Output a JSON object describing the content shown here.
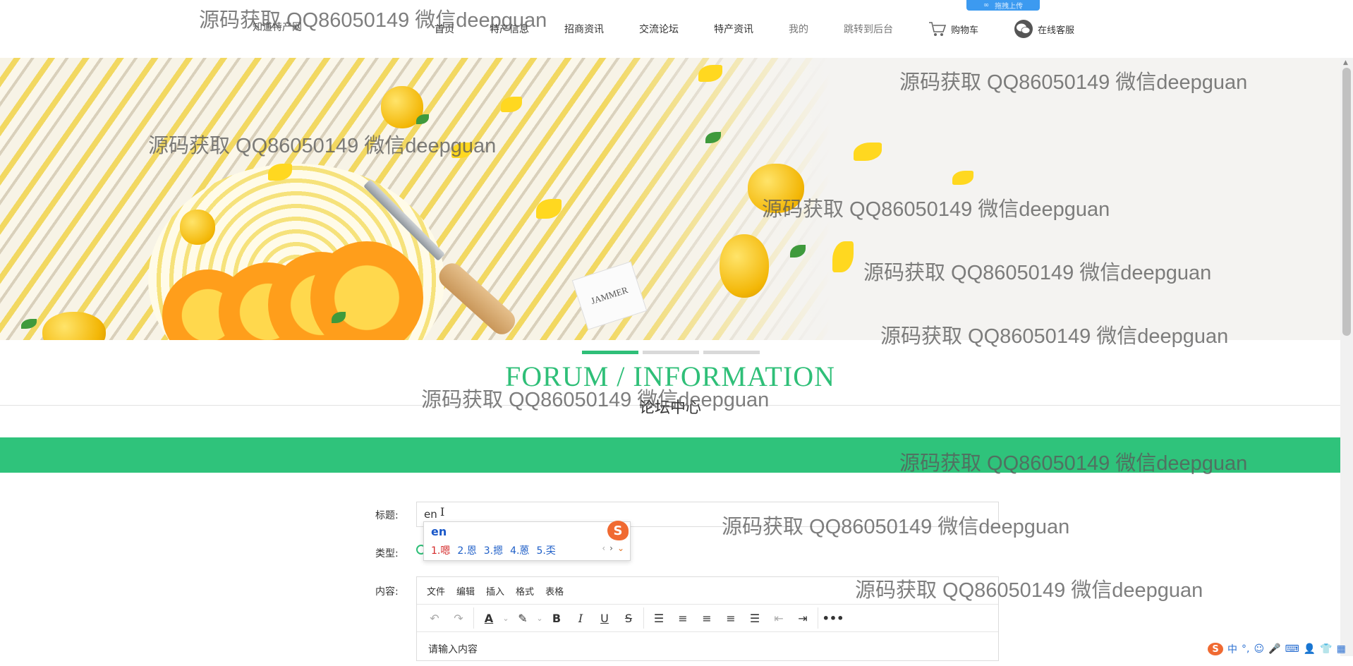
{
  "header": {
    "site_name": "知道特产网",
    "nav": [
      "首页",
      "特产信息",
      "招商资讯",
      "交流论坛",
      "特产资讯",
      "我的",
      "跳转到后台"
    ],
    "cart_label": "购物车",
    "service_label": "在线客服",
    "upload_badge": "拖拽上传"
  },
  "banner": {
    "tag_text": "JAMMER",
    "slides": 3,
    "active_slide": 1
  },
  "section": {
    "title": "FORUM / INFORMATION",
    "subtitle": "论坛中心"
  },
  "form": {
    "title_label": "标题:",
    "title_value": "en",
    "type_label": "类型:",
    "content_label": "内容:",
    "editor_menu": [
      "文件",
      "编辑",
      "插入",
      "格式",
      "表格"
    ],
    "editor_placeholder": "请输入内容"
  },
  "ime": {
    "composition": "en",
    "candidates": [
      "1.嗯",
      "2.恩",
      "3.摁",
      "4.蒽",
      "5.奀"
    ]
  },
  "watermark": "源码获取 QQ86050149 微信deepguan",
  "tray": [
    "中",
    "°,",
    "☺",
    "🎤",
    "⌨",
    "👤",
    "👕",
    "▦"
  ],
  "colors": {
    "accent": "#2fc37b",
    "banner_yellow": "#f2d861",
    "ime_blue": "#2060c8"
  }
}
